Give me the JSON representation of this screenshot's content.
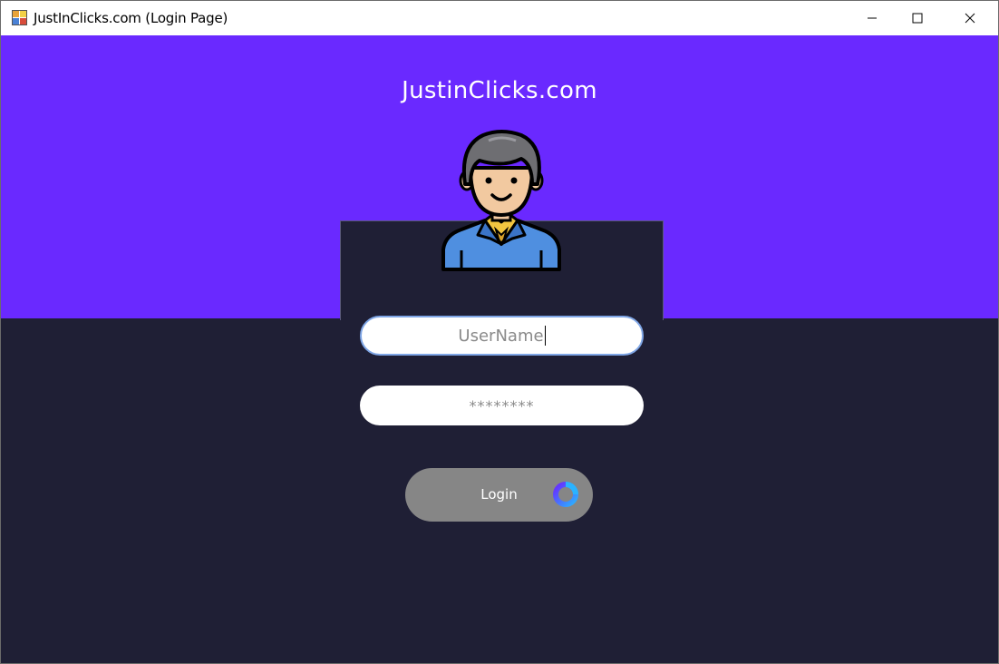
{
  "window": {
    "title": "JustInClicks.com (Login Page)",
    "minimize_icon": "minimize-icon",
    "maximize_icon": "maximize-icon",
    "close_icon": "close-icon"
  },
  "header": {
    "brand": "JustinClicks.com",
    "band_color": "#6a29ff"
  },
  "form": {
    "username": {
      "value": "",
      "placeholder": "UserName"
    },
    "password": {
      "value": "",
      "placeholder": "********"
    },
    "login_label": "Login"
  },
  "colors": {
    "background": "#1f1f35",
    "accent": "#6a29ff",
    "button": "#868686",
    "spinner_start": "#6a29ff",
    "spinner_end": "#2ab3ff"
  },
  "icons": {
    "app": "app-icon",
    "avatar": "user-avatar-icon",
    "spinner": "loading-spinner-icon"
  }
}
